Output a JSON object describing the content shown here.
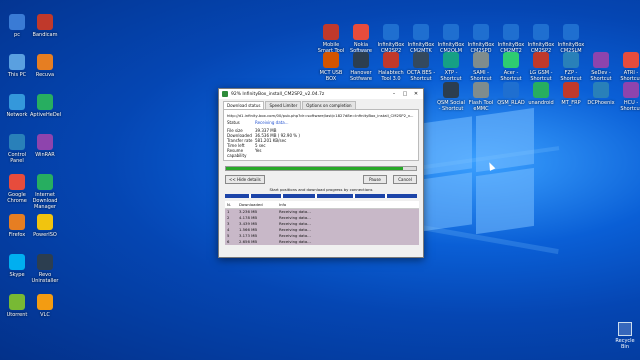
{
  "desktop": {
    "left_icons": [
      {
        "label": "pc",
        "color": "#3a7bd5"
      },
      {
        "label": "Bandicam",
        "color": "#c0392b"
      },
      {
        "label": "This PC",
        "color": "#5aa0e0"
      },
      {
        "label": "Recuva",
        "color": "#e67e22"
      },
      {
        "label": "Network",
        "color": "#3498db"
      },
      {
        "label": "AptiveHeDel",
        "color": "#27ae60"
      },
      {
        "label": "Control Panel",
        "color": "#2980b9"
      },
      {
        "label": "WinRAR",
        "color": "#8e44ad"
      },
      {
        "label": "Google Chrome",
        "color": "#e74c3c"
      },
      {
        "label": "Internet Download Manager",
        "color": "#27ae60"
      },
      {
        "label": "Firefox",
        "color": "#e67e22"
      },
      {
        "label": "PowerISO",
        "color": "#f1c40f"
      },
      {
        "label": "Skype",
        "color": "#00aff0"
      },
      {
        "label": "Revo Uninstaller",
        "color": "#2c3e50"
      },
      {
        "label": "Utorrent",
        "color": "#78b934"
      },
      {
        "label": "VLC",
        "color": "#f39c12"
      }
    ],
    "top_icons": [
      {
        "label": "Mobile Smart Tool",
        "color": "#c0392b"
      },
      {
        "label": "Nokia Software",
        "color": "#e74c3c"
      },
      {
        "label": "InfinityBox CM2SP2",
        "color": "#1f6fd0"
      },
      {
        "label": "InfinityBox CM2MTK",
        "color": "#1f6fd0"
      },
      {
        "label": "InfinityBox CM2QLM",
        "color": "#1f6fd0"
      },
      {
        "label": "InfinityBox CM2SPD",
        "color": "#1f6fd0"
      },
      {
        "label": "InfinityBox CM2MT2",
        "color": "#1f6fd0"
      },
      {
        "label": "InfinityBox CM2SP2",
        "color": "#1f6fd0"
      },
      {
        "label": "InfinityBox CM2SLM",
        "color": "#1f6fd0"
      }
    ],
    "mid_icons": [
      {
        "label": "MCT USB BOX",
        "color": "#d35400"
      },
      {
        "label": "Hanover Sotfware",
        "color": "#2c3e50"
      },
      {
        "label": "Halabtech Tool 3.0",
        "color": "#c0392b"
      },
      {
        "label": "OCTA BES - Shortcut",
        "color": "#34495e"
      },
      {
        "label": "XTP - Shortcut",
        "color": "#16a085"
      },
      {
        "label": "SAMI - Shortcut",
        "color": "#7f8c8d"
      },
      {
        "label": "Acer - Shortcut",
        "color": "#2ecc71"
      },
      {
        "label": "LG GSM - Shortcut",
        "color": "#c0392b"
      },
      {
        "label": "FZP - Shortcut",
        "color": "#2980b9"
      },
      {
        "label": "SeDev - Shortcut",
        "color": "#8e44ad"
      },
      {
        "label": "ATRI - Shortcut",
        "color": "#e74c3c"
      }
    ],
    "bottom_icons": [
      {
        "label": "QSM Social - Shortcut",
        "color": "#2c3e50"
      },
      {
        "label": "Flash Tool eMMC",
        "color": "#7f8c8d"
      },
      {
        "label": "QSM_RLAD",
        "color": "#1f6fd0"
      },
      {
        "label": "unandroid",
        "color": "#27ae60"
      },
      {
        "label": "MT_FRP",
        "color": "#c0392b"
      },
      {
        "label": "DCPhoenix",
        "color": "#2980b9"
      },
      {
        "label": "HCU - Shortcut",
        "color": "#8e44ad"
      }
    ],
    "recycle_bin": "Recycle Bin"
  },
  "idm_window": {
    "title": "92% InfinityBox_install_CM2SP2_v2.04.7z",
    "tabs": [
      "Download status",
      "Speed Limiter",
      "Options on completion"
    ],
    "url": "http://d1.infinity-box.com/00/pub.php?dr=software/last/c1827d8e=InfinityBox_install_CM2SP2_v...",
    "status_label": "Status",
    "status_value": "Receiving data...",
    "rows": [
      {
        "key": "File size",
        "value": "39.337 MB"
      },
      {
        "key": "Downloaded",
        "value": "36.536 MB ( 92.90 % )"
      },
      {
        "key": "Transfer rate",
        "value": "581.201 KB/sec"
      },
      {
        "key": "Time left",
        "value": "5 sec"
      },
      {
        "key": "Resume capability",
        "value": "Yes"
      }
    ],
    "progress": 0.929,
    "hide_details": "<< Hide details",
    "pause": "Pause",
    "cancel": "Cancel",
    "connections_label": "Start positions and download progress by connections",
    "table_headers": [
      "N.",
      "Downloaded",
      "Info"
    ],
    "connections": [
      {
        "n": "1",
        "downloaded": "3.236 MB",
        "info": "Receiving data..."
      },
      {
        "n": "2",
        "downloaded": "4.178 MB",
        "info": "Receiving data..."
      },
      {
        "n": "3",
        "downloaded": "3.439 MB",
        "info": "Receiving data..."
      },
      {
        "n": "4",
        "downloaded": "1.566 MB",
        "info": "Receiving data..."
      },
      {
        "n": "5",
        "downloaded": "3.173 MB",
        "info": "Receiving data..."
      },
      {
        "n": "6",
        "downloaded": "2.656 MB",
        "info": "Receiving data..."
      }
    ]
  }
}
